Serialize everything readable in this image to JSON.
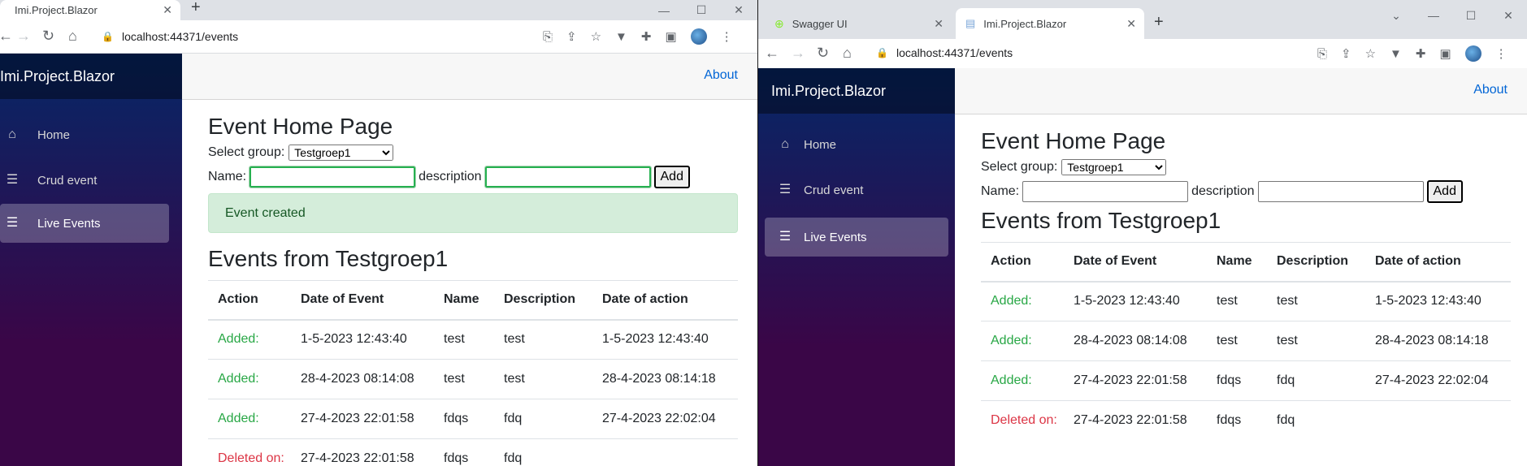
{
  "left": {
    "tab_title": "Imi.Project.Blazor",
    "url": "localhost:44371/events",
    "brand": "Imi.Project.Blazor",
    "nav": [
      {
        "label": "Home",
        "icon": "home-icon"
      },
      {
        "label": "Crud event",
        "icon": "list-icon"
      },
      {
        "label": "Live Events",
        "icon": "list-icon"
      }
    ],
    "about": "About",
    "page_title": "Event Home Page",
    "select_label": "Select group:",
    "selected_group": "Testgroep1",
    "name_label": "Name:",
    "description_label": "description",
    "add_label": "Add",
    "alert": "Event created",
    "events_title": "Events from Testgroep1",
    "columns": [
      "Action",
      "Date of Event",
      "Name",
      "Description",
      "Date of action"
    ],
    "rows": [
      {
        "action": "Added:",
        "date": "1-5-2023 12:43:40",
        "name": "test",
        "description": "test",
        "action_date": "1-5-2023 12:43:40"
      },
      {
        "action": "Added:",
        "date": "28-4-2023 08:14:08",
        "name": "test",
        "description": "test",
        "action_date": "28-4-2023 08:14:18"
      },
      {
        "action": "Added:",
        "date": "27-4-2023 22:01:58",
        "name": "fdqs",
        "description": "fdq",
        "action_date": "27-4-2023 22:02:04"
      },
      {
        "action": "Deleted on:",
        "date": "27-4-2023 22:01:58",
        "name": "fdqs",
        "description": "fdq",
        "action_date": ""
      }
    ]
  },
  "right": {
    "tabs": [
      {
        "title": "Swagger UI"
      },
      {
        "title": "Imi.Project.Blazor"
      }
    ],
    "url": "localhost:44371/events",
    "brand": "Imi.Project.Blazor",
    "nav": [
      {
        "label": "Home",
        "icon": "home-icon"
      },
      {
        "label": "Crud event",
        "icon": "list-icon"
      },
      {
        "label": "Live Events",
        "icon": "list-icon"
      }
    ],
    "about": "About",
    "page_title": "Event Home Page",
    "select_label": "Select group:",
    "selected_group": "Testgroep1",
    "name_label": "Name:",
    "description_label": "description",
    "add_label": "Add",
    "events_title": "Events from Testgroep1",
    "columns": [
      "Action",
      "Date of Event",
      "Name",
      "Description",
      "Date of action"
    ],
    "rows": [
      {
        "action": "Added:",
        "date": "1-5-2023 12:43:40",
        "name": "test",
        "description": "test",
        "action_date": "1-5-2023 12:43:40"
      },
      {
        "action": "Added:",
        "date": "28-4-2023 08:14:08",
        "name": "test",
        "description": "test",
        "action_date": "28-4-2023 08:14:18"
      },
      {
        "action": "Added:",
        "date": "27-4-2023 22:01:58",
        "name": "fdqs",
        "description": "fdq",
        "action_date": "27-4-2023 22:02:04"
      },
      {
        "action": "Deleted on:",
        "date": "27-4-2023 22:01:58",
        "name": "fdqs",
        "description": "fdq",
        "action_date": ""
      }
    ]
  },
  "colors": {
    "added": "#28a745",
    "deleted": "#dc3545",
    "link": "#0366d6",
    "alert_bg": "#d4edda"
  }
}
